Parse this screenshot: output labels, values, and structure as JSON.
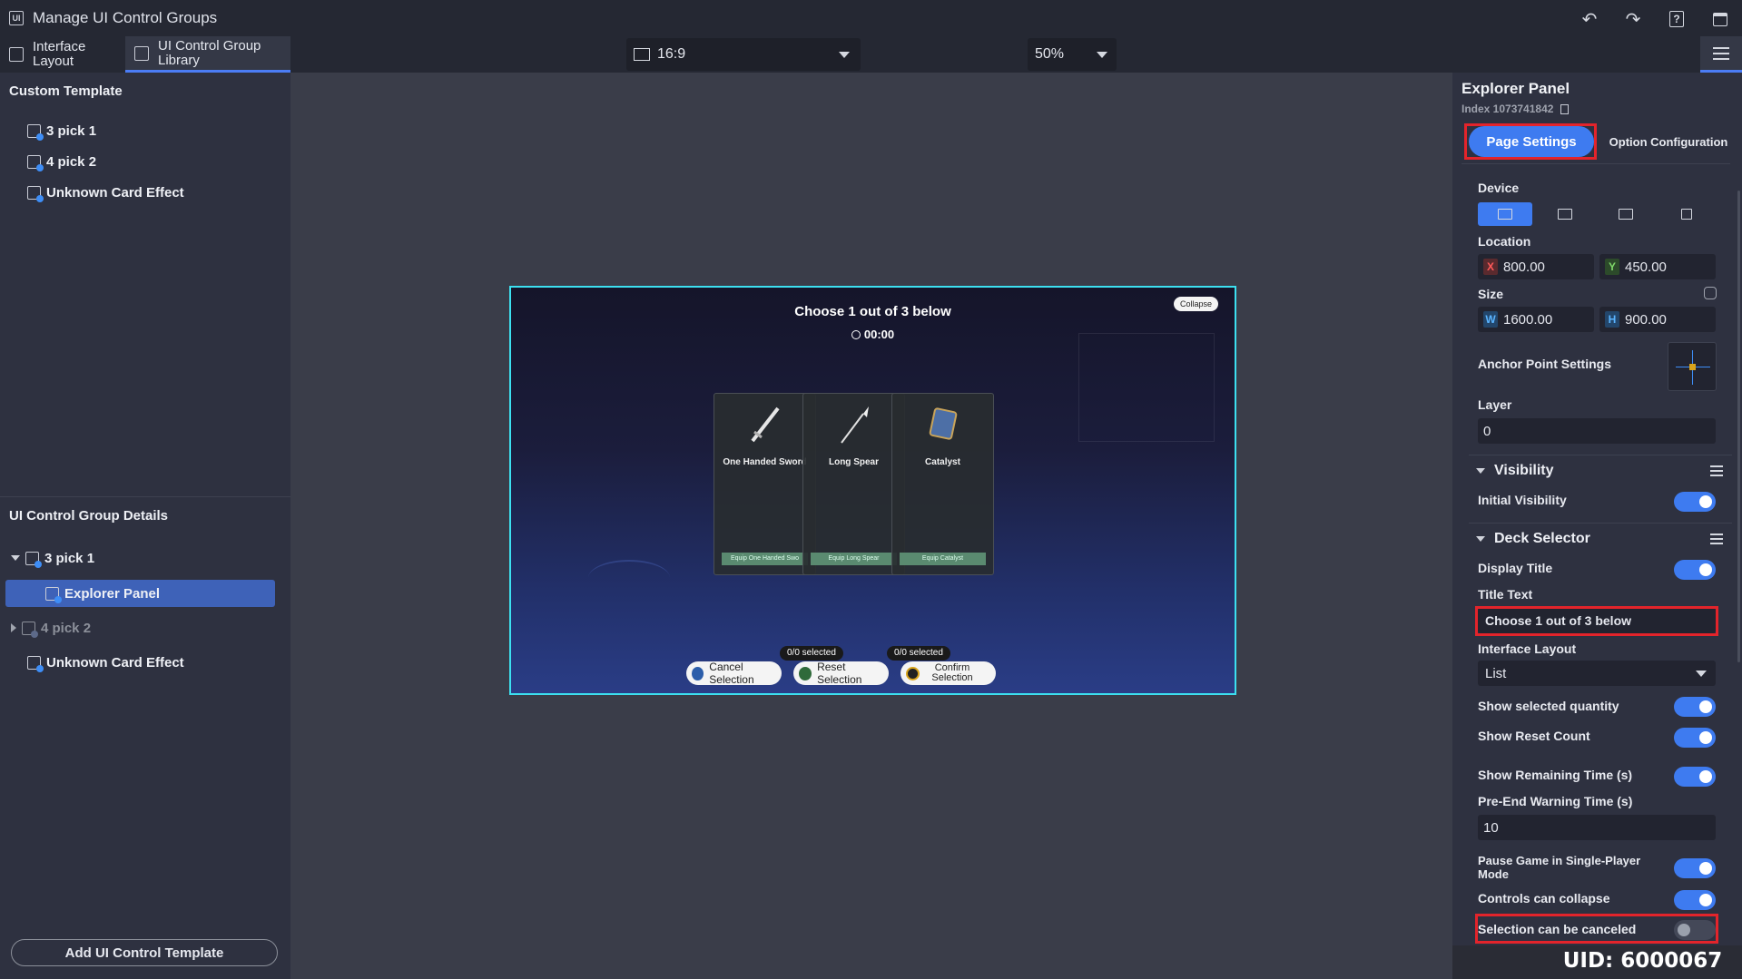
{
  "window": {
    "title": "Manage UI Control Groups",
    "app_icon": "UI"
  },
  "tabs": [
    {
      "label": "Interface Layout",
      "active": false
    },
    {
      "label": "UI Control Group Library",
      "active": true
    }
  ],
  "toolbar": {
    "aspect_ratio": "16:9",
    "zoom": "50%"
  },
  "left_panel": {
    "custom_template_title": "Custom Template",
    "custom_templates": [
      "3 pick 1",
      "4 pick 2",
      "Unknown Card Effect"
    ],
    "details_title": "UI Control Group Details",
    "details_tree": {
      "group1": "3 pick 1",
      "selected_child": "Explorer Panel",
      "group2": "4 pick 2",
      "item": "Unknown Card Effect"
    },
    "add_button": "Add UI Control Template"
  },
  "preview": {
    "title": "Choose 1 out of 3 below",
    "timer": "00:00",
    "collapse_label": "Collapse",
    "cards": [
      {
        "name": "One Handed Sword",
        "button": "Equip One Handed Swo"
      },
      {
        "name": "Long Spear",
        "button": "Equip Long Spear"
      },
      {
        "name": "Catalyst",
        "button": "Equip Catalyst"
      }
    ],
    "actions": {
      "cancel": "Cancel Selection",
      "reset": "Reset Selection",
      "confirm": "Confirm Selection",
      "reset_badge": "0/0 selected",
      "confirm_badge": "0/0 selected"
    }
  },
  "right_panel": {
    "title": "Explorer Panel",
    "index_label": "Index 1073741842",
    "tab_page_settings": "Page Settings",
    "tab_option_config": "Option Configuration",
    "device_label": "Device",
    "location_label": "Location",
    "location_x": "800.00",
    "location_y": "450.00",
    "size_label": "Size",
    "size_w": "1600.00",
    "size_h": "900.00",
    "anchor_label": "Anchor Point Settings",
    "layer_label": "Layer",
    "layer_value": "0",
    "visibility_section": "Visibility",
    "initial_visibility": "Initial Visibility",
    "deck_section": "Deck Selector",
    "display_title": "Display Title",
    "title_text_label": "Title Text",
    "title_text_value": "Choose 1 out of 3 below",
    "interface_layout_label": "Interface Layout",
    "interface_layout_value": "List",
    "show_selected_quantity": "Show selected quantity",
    "show_reset_count": "Show Reset Count",
    "show_remaining_time": "Show Remaining Time (s)",
    "pre_end_warning": "Pre-End Warning Time (s)",
    "pre_end_value": "10",
    "pause_game": "Pause Game in Single-Player Mode",
    "controls_collapse": "Controls can collapse",
    "selection_cancel": "Selection can be canceled",
    "toggles": {
      "initial_visibility": true,
      "display_title": true,
      "show_selected_quantity": true,
      "show_reset_count": true,
      "show_remaining_time": true,
      "pause_game": true,
      "controls_collapse": true,
      "selection_cancel": false
    }
  },
  "uid": "UID: 6000067",
  "colors": {
    "accent": "#3e7bf0",
    "highlight": "#e3242b",
    "preview_border": "#3ce0f0"
  }
}
